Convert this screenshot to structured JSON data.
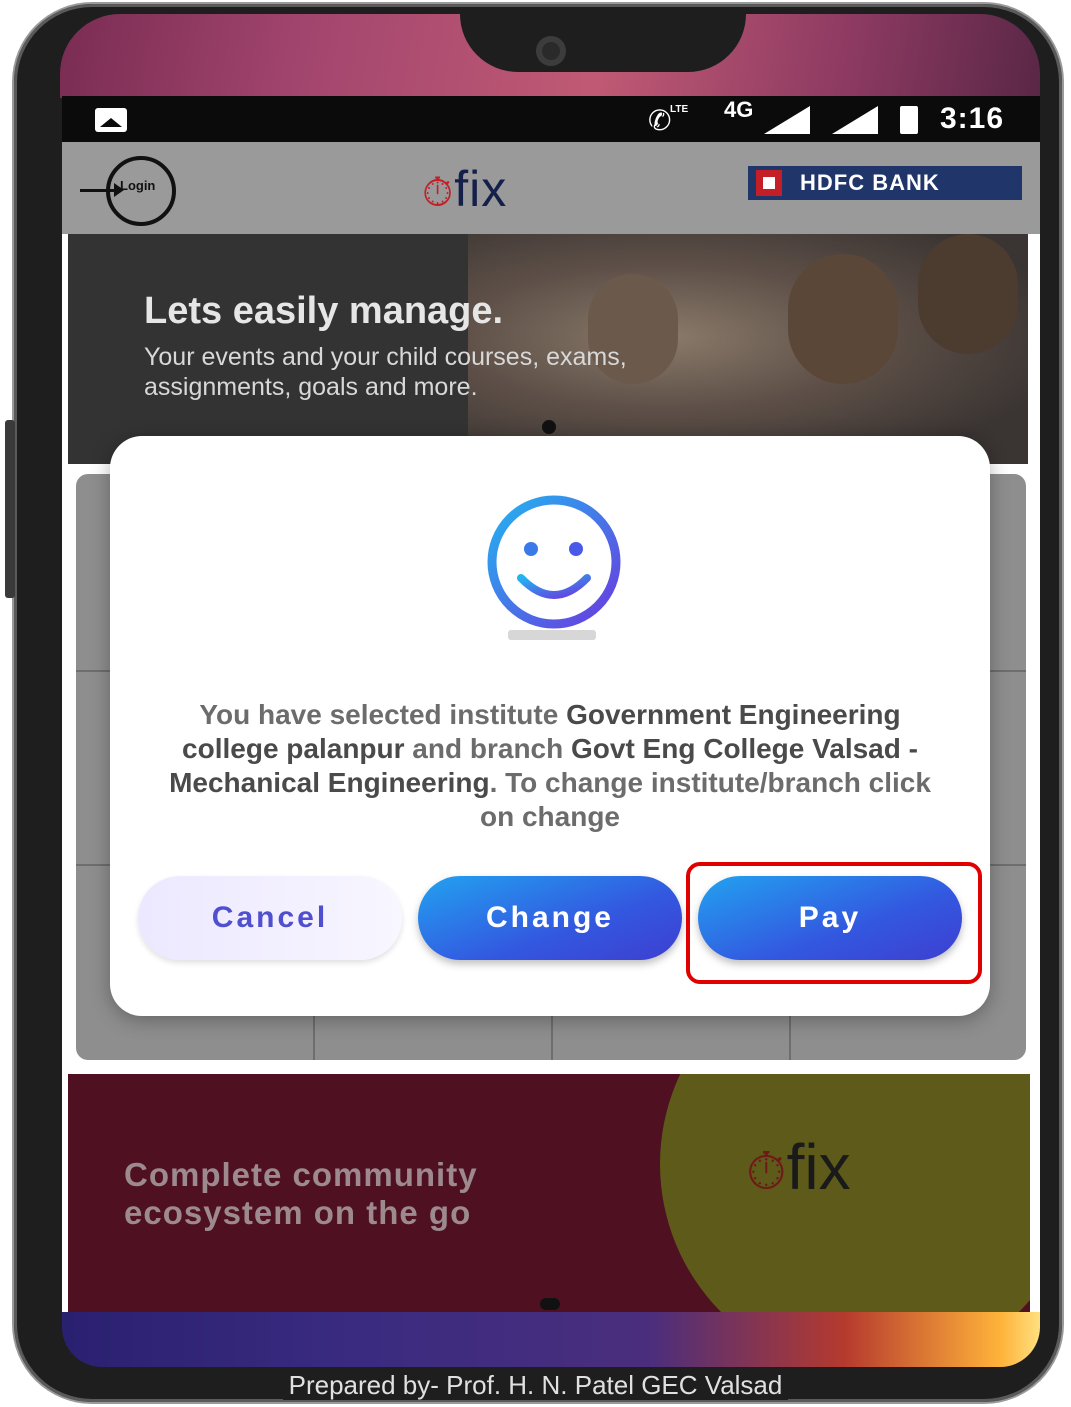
{
  "status_bar": {
    "time": "3:16",
    "network": "4G",
    "lte": "LTE"
  },
  "header": {
    "login_label": "Login",
    "logo_text": "fix",
    "bank_name": "HDFC BANK"
  },
  "banner": {
    "title": "Lets easily manage.",
    "subtitle": "Your events and your child courses, exams, assignments, goals and more."
  },
  "promo": {
    "text_line1": "Complete community",
    "text_line2": "ecosystem on the go",
    "logo_text": "fix"
  },
  "dialog": {
    "msg_part1": "You have selected institute ",
    "institute": "Government Engineering college palanpur",
    "msg_part2": " and branch ",
    "branch": "Govt Eng College Valsad - Mechanical Engineering",
    "msg_part3": ". To change institute/branch click on change",
    "cancel_label": "Cancel",
    "change_label": "Change",
    "pay_label": "Pay"
  },
  "footer": {
    "credit": "Prepared by- Prof. H. N. Patel GEC Valsad"
  },
  "colors": {
    "accent_blue": "#3358e0",
    "highlight_red": "#e00000",
    "brand_red": "#c41f26",
    "promo_bg": "#4f1022"
  }
}
